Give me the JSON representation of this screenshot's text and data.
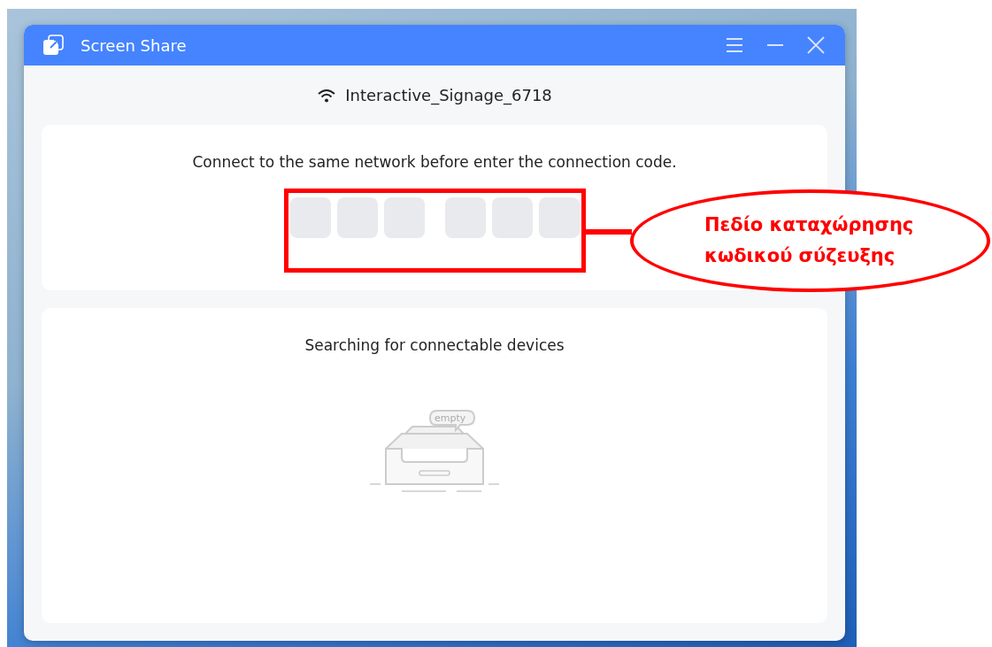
{
  "window": {
    "title": "Screen Share"
  },
  "network": {
    "name": "Interactive_Signage_6718"
  },
  "code_card": {
    "instruction": "Connect to the same network before enter the connection code.",
    "code_groups": [
      [
        {
          "focused": false
        },
        {
          "focused": false
        },
        {
          "focused": false
        }
      ],
      [
        {
          "focused": false
        },
        {
          "focused": false
        },
        {
          "focused": false
        }
      ]
    ]
  },
  "devices_card": {
    "status": "Searching for connectable devices",
    "empty_label": "empty"
  },
  "annotation": {
    "lines": [
      "Πεδίο καταχώρησης",
      "κωδικού σύζευξης"
    ]
  }
}
